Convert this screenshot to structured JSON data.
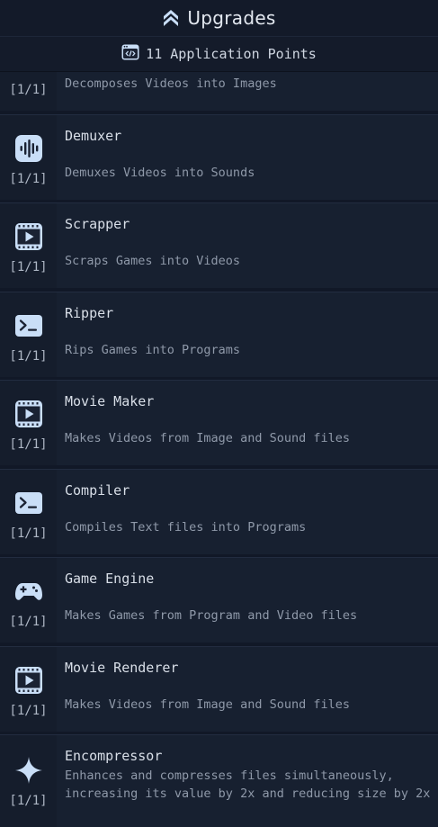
{
  "header": {
    "title": "Upgrades",
    "icon": "double-chevron-up-icon"
  },
  "points": {
    "label": "11 Application Points",
    "icon": "code-window-icon"
  },
  "colors": {
    "background": "#111827",
    "item_bg": "#172030",
    "accent": "#c9def7"
  },
  "upgrades": [
    {
      "name": "",
      "count": "[1/1]",
      "description": "Decomposes Videos into Images",
      "icon": "image-icon"
    },
    {
      "name": "Demuxer",
      "count": "[1/1]",
      "description": "Demuxes Videos into Sounds",
      "icon": "audio-wave-icon"
    },
    {
      "name": "Scrapper",
      "count": "[1/1]",
      "description": "Scraps Games into Videos",
      "icon": "video-file-icon"
    },
    {
      "name": "Ripper",
      "count": "[1/1]",
      "description": "Rips Games into Programs",
      "icon": "terminal-icon"
    },
    {
      "name": "Movie Maker",
      "count": "[1/1]",
      "description": "Makes Videos from Image and Sound files",
      "icon": "video-file-icon"
    },
    {
      "name": "Compiler",
      "count": "[1/1]",
      "description": "Compiles Text files into Programs",
      "icon": "terminal-icon"
    },
    {
      "name": "Game Engine",
      "count": "[1/1]",
      "description": "Makes Games from Program and Video files",
      "icon": "gamepad-icon"
    },
    {
      "name": "Movie Renderer",
      "count": "[1/1]",
      "description": "Makes Videos from Image and Sound files",
      "icon": "video-file-icon"
    },
    {
      "name": "Encompressor",
      "count": "[1/1]",
      "description": "Enhances and compresses files simultaneously, increasing its value by 2x and reducing size by 2x",
      "icon": "sparkle-icon"
    }
  ]
}
